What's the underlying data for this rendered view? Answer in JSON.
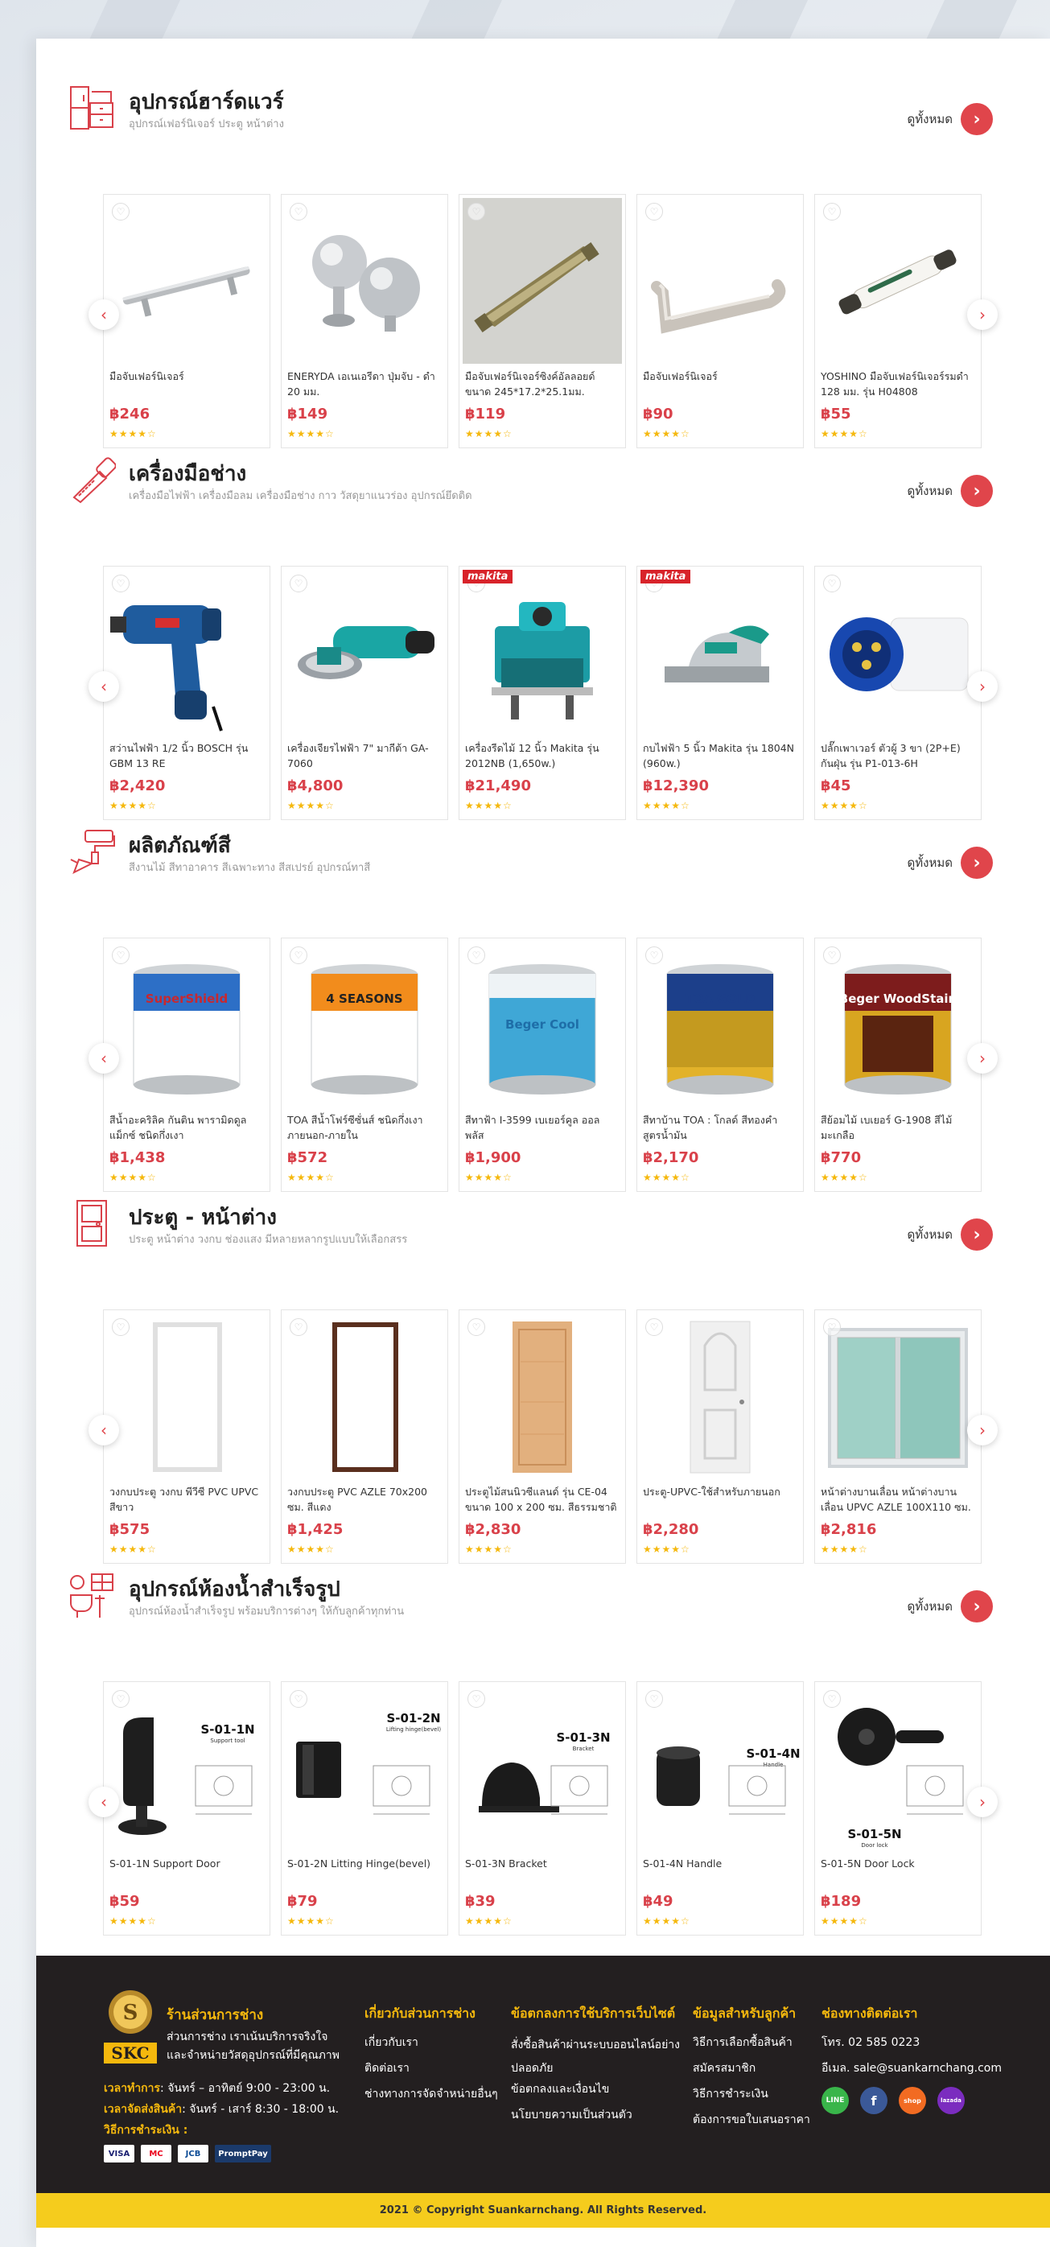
{
  "view_all": "ดูทั้งหมด",
  "sections": [
    {
      "title": "อุปกรณ์ฮาร์ดแวร์",
      "subtitle": "อุปกรณ์เฟอร์นิเจอร์ ประตู หน้าต่าง",
      "icon": "cabinet-icon",
      "products": [
        {
          "name": "มือจับเฟอร์นิเจอร์",
          "price": "฿246"
        },
        {
          "name": "ENERYDA เอเนเอรีดา ปุ่มจับ - ดำ 20 มม.",
          "price": "฿149"
        },
        {
          "name": "มือจับเฟอร์นิเจอร์ซิงค์อัลลอยด์ ขนาด 245*17.2*25.1มม.",
          "price": "฿119"
        },
        {
          "name": "มือจับเฟอร์นิเจอร์",
          "price": "฿90"
        },
        {
          "name": "YOSHINO มือจับเฟอร์นิเจอร์รมดำ 128 มม. รุ่น H04808",
          "price": "฿55"
        }
      ]
    },
    {
      "title": "เครื่องมือช่าง",
      "subtitle": "เครื่องมือไฟฟ้า เครื่องมือลม เครื่องมือช่าง กาว วัสดุยาแนวร่อง อุปกรณ์ยึดติด",
      "icon": "saw-icon",
      "products": [
        {
          "name": "สว่านไฟฟ้า 1/2 นิ้ว BOSCH รุ่น GBM 13 RE",
          "price": "฿2,420"
        },
        {
          "name": "เครื่องเจียรไฟฟ้า 7\" มากีต้า GA-7060",
          "price": "฿4,800"
        },
        {
          "name": "เครื่องรีดไม้ 12 นิ้ว Makita รุ่น 2012NB (1,650w.)",
          "price": "฿21,490",
          "badge": "makita"
        },
        {
          "name": "กบไฟฟ้า 5 นิ้ว Makita รุ่น 1804N (960w.)",
          "price": "฿12,390",
          "badge": "makita"
        },
        {
          "name": "ปลั๊กเพาเวอร์ ตัวผู้ 3 ขา (2P+E) กันฝุ่น รุ่น P1-013-6H",
          "price": "฿45"
        }
      ]
    },
    {
      "title": "ผลิตภัณฑ์สี",
      "subtitle": "สีงานไม้ สีทาอาคาร สีเฉพาะทาง สีสเปรย์ อุปกรณ์ทาสี",
      "icon": "paint-roller-icon",
      "products": [
        {
          "name": "สีน้ำอะคริลิค กันติน พารามิดดูล แม็กซ์ ชนิดกึ่งเงา",
          "price": "฿1,438"
        },
        {
          "name": "TOA สีน้ำโฟร์ซีซั่นส์ ชนิดกึ่งเงา ภายนอก-ภายใน",
          "price": "฿572"
        },
        {
          "name": "สีทาฟ้า I-3599 เบเยอร์คูล ออล พลัส",
          "price": "฿1,900"
        },
        {
          "name": "สีทาบ้าน TOA : โกลด์ สีทองคำ สูตรน้ำมัน",
          "price": "฿2,170"
        },
        {
          "name": "สีย้อมไม้ เบเยอร์ G-1908 สีไม้มะเกลือ",
          "price": "฿770"
        }
      ]
    },
    {
      "title": "ประตู - หน้าต่าง",
      "subtitle": "ประตู หน้าต่าง วงกบ ช่องแสง มีหลายหลากรูปแบบให้เลือกสรร",
      "icon": "door-icon",
      "products": [
        {
          "name": "วงกบประตู วงกบ พีวีซี PVC UPVC สีขาว",
          "price": "฿575"
        },
        {
          "name": "วงกบประตู PVC AZLE 70x200 ซม. สีแดง",
          "price": "฿1,425"
        },
        {
          "name": "ประตูไม้สนนิวซีแลนด์ รุ่น CE-04 ขนาด 100 x 200 ซม. สีธรรมชาติ",
          "price": "฿2,830"
        },
        {
          "name": "ประตู-UPVC-ใช้สำหรับภายนอก",
          "price": "฿2,280"
        },
        {
          "name": "หน้าต่างบานเลื่อน หน้าต่างบานเลื่อน UPVC AZLE 100X110 ซม.",
          "price": "฿2,816"
        }
      ]
    },
    {
      "title": "อุปกรณ์ห้องน้ำสำเร็จรูป",
      "subtitle": "อุปกรณ์ห้องน้ำสำเร็จรูป พร้อมบริการต่างๆ ให้กับลูกค้าทุกท่าน",
      "icon": "bathroom-icon",
      "products": [
        {
          "name": "S-01-1N Support Door",
          "price": "฿59",
          "code": "S-01-1N",
          "code_sub": "Support tool"
        },
        {
          "name": "S-01-2N Litting Hinge(bevel)",
          "price": "฿79",
          "code": "S-01-2N",
          "code_sub": "Lifting hinge(bevel)"
        },
        {
          "name": "S-01-3N Bracket",
          "price": "฿39",
          "code": "S-01-3N",
          "code_sub": "Bracket"
        },
        {
          "name": "S-01-4N Handle",
          "price": "฿49",
          "code": "S-01-4N",
          "code_sub": "Handle"
        },
        {
          "name": "S-01-5N Door Lock",
          "price": "฿189",
          "code": "S-01-5N",
          "code_sub": "Door lock"
        }
      ]
    }
  ],
  "stars": "★★★★☆",
  "footer": {
    "logo_text": "SKC",
    "brand_title": "ร้านส่วนการช่าง",
    "brand_desc_1": "ส่วนการช่าง เราเน้นบริการจริงใจ",
    "brand_desc_2": "และจำหน่ายวัสดุอุปกรณ์ที่มีคุณภาพ",
    "hours_label": "เวลาทำการ",
    "hours_value": ": จันทร์ – อาทิตย์ 9:00 - 23:00 น.",
    "delivery_label": "เวลาจัดส่งสินค้า",
    "delivery_value": ": จันทร์ - เสาร์ 8:30 - 18:00 น.",
    "payment_label": "วิธีการชำระเงิน :",
    "payments": [
      "VISA",
      "MC",
      "JCB",
      "PromptPay"
    ],
    "col_about": {
      "title": "เกี่ยวกับส่วนการช่าง",
      "links": [
        "เกี่ยวกับเรา",
        "ติดต่อเรา",
        "ช่างทางการจัดจำหน่ายอื่นๆ"
      ]
    },
    "col_terms": {
      "title": "ข้อตกลงการใช้บริการเว็บไซต์",
      "links": [
        "สั่งซื้อสินค้าผ่านระบบออนไลน์อย่างปลอดภัย",
        "ข้อตกลงและเงื่อนไข",
        "นโยบายความเป็นส่วนตัว"
      ]
    },
    "col_info": {
      "title": "ข้อมูลสำหรับลูกค้า",
      "links": [
        "วิธีการเลือกซื้อสินค้า",
        "สมัครสมาชิก",
        "วิธีการชำระเงิน",
        "ต้องการขอใบเสนอราคา"
      ]
    },
    "col_contact": {
      "title": "ช่องทางติดต่อเรา",
      "phone": "โทร. 02 585 0223",
      "email": "อีเมล. sale@suankarnchang.com"
    },
    "socials": [
      "LINE",
      "f",
      "shop",
      "lazada"
    ],
    "copyright": "2021 © Copyright Suankarnchang. All Rights Reserved.",
    "colors": {
      "accent": "#e0454b",
      "footer_bg": "#231f20",
      "bar": "#f5cc1d",
      "heading": "#f5b80d"
    }
  }
}
